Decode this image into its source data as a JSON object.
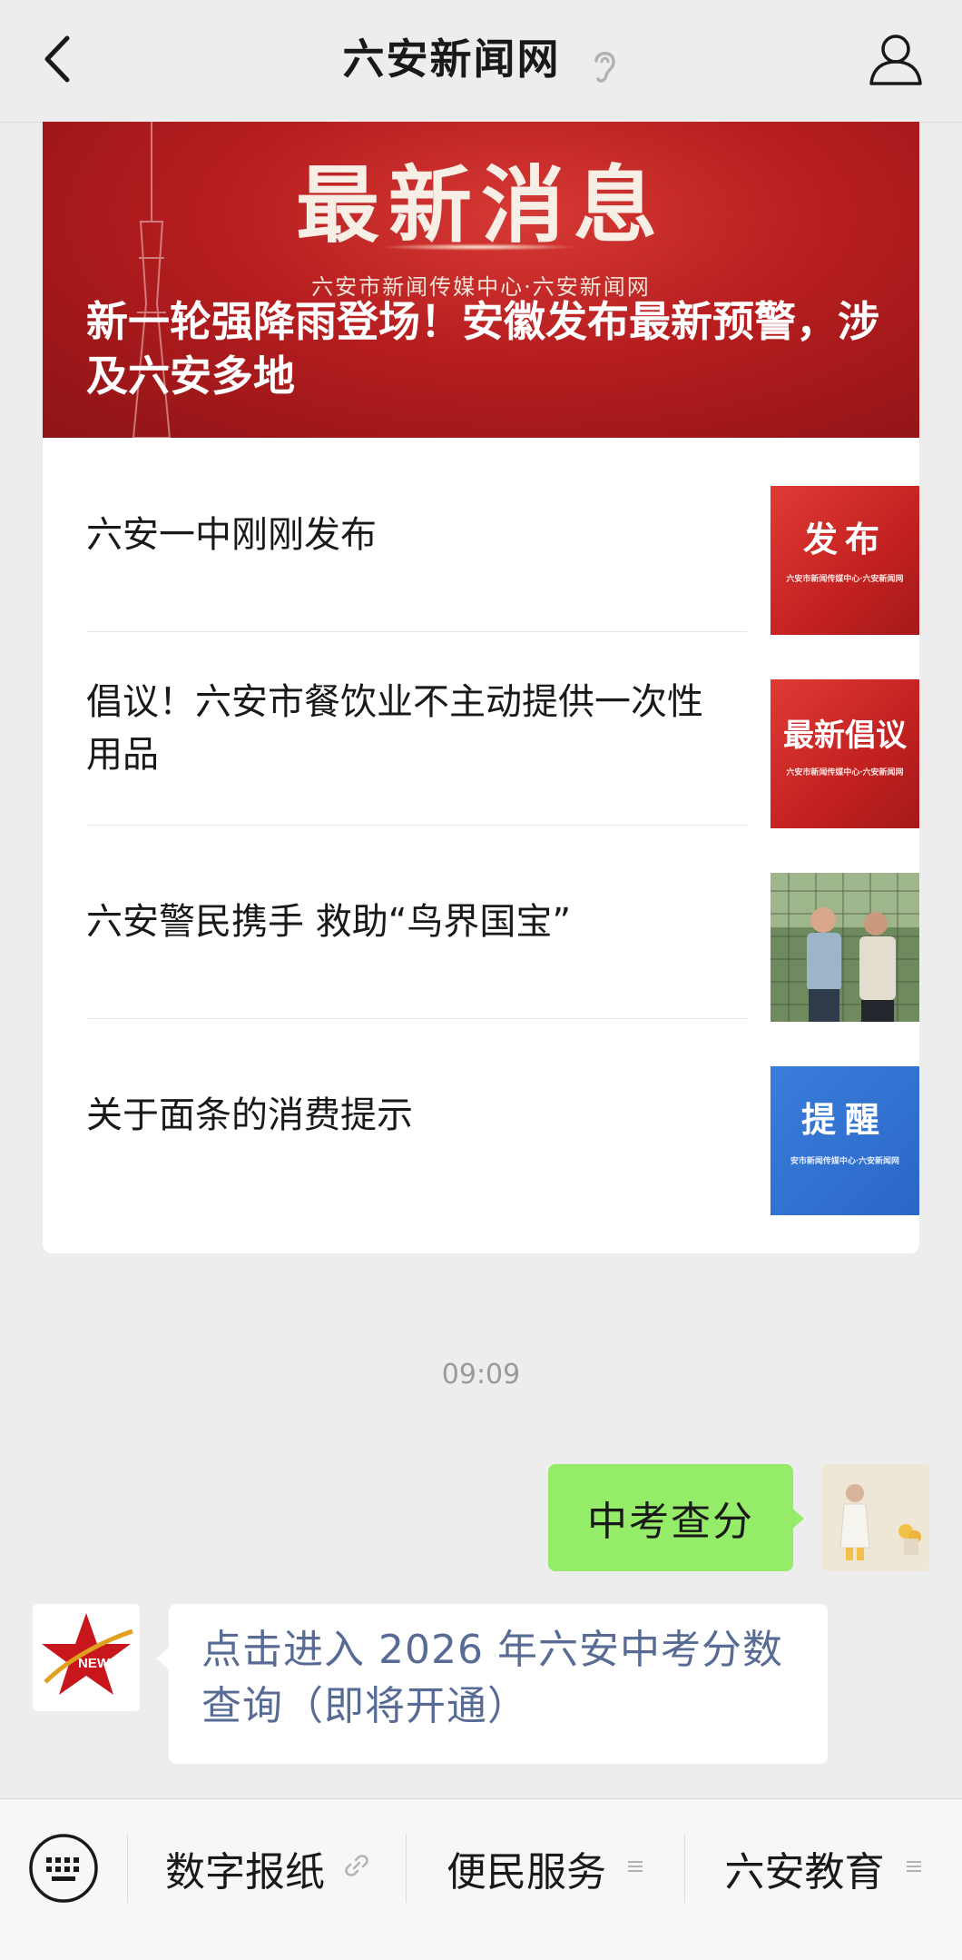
{
  "header": {
    "title": "六安新闻网"
  },
  "banner": {
    "heading": "最新消息",
    "subtitle": "六安市新闻传媒中心·六安新闻网",
    "title": "新一轮强降雨登场！安徽发布最新预警，涉及六安多地"
  },
  "articles": [
    {
      "title": "六安一中刚刚发布",
      "thumb_text": "发布",
      "thumb_sub": "六安市新闻传媒中心·六安新闻网"
    },
    {
      "title": "倡议！六安市餐饮业不主动提供一次性用品",
      "thumb_text": "最新倡议",
      "thumb_sub": "六安市新闻传媒中心·六安新闻网"
    },
    {
      "title": "六安警民携手 救助“鸟界国宝”"
    },
    {
      "title": "关于面条的消费提示",
      "thumb_text": "提醒",
      "thumb_sub": "安市新闻传媒中心·六安新闻网"
    }
  ],
  "chat": {
    "time": "09:09",
    "sent_message": "中考查分",
    "received_message": "点击进入 2026 年六安中考分数查询（即将开通）",
    "bot_avatar_label": "NEWS"
  },
  "menu": {
    "items": [
      {
        "label": "数字报纸",
        "icon": "link-icon"
      },
      {
        "label": "便民服务",
        "icon": "menu-lines-icon"
      },
      {
        "label": "六安教育",
        "icon": "menu-lines-icon"
      }
    ]
  },
  "colors": {
    "sent_bubble": "#95ec69",
    "link_text": "#576b95",
    "banner_red": "#b61d1f",
    "background": "#ededed"
  }
}
